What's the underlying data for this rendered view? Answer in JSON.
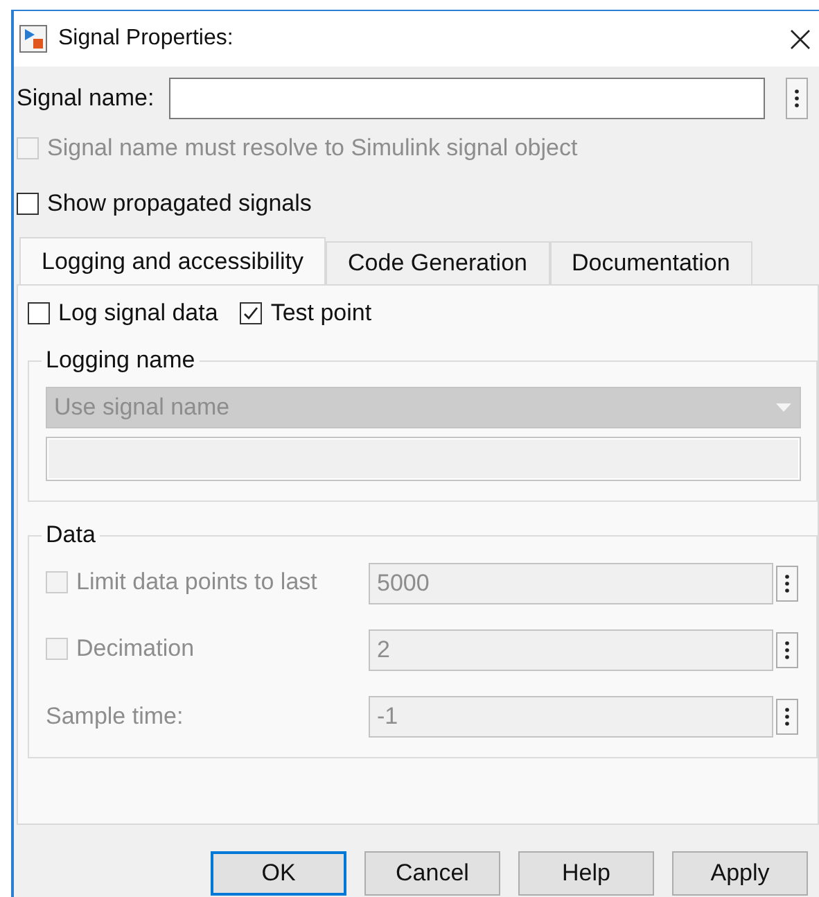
{
  "window": {
    "title": "Signal Properties:"
  },
  "signal_name": {
    "label": "Signal name:"
  },
  "options": [
    {
      "label": "Signal name must resolve to Simulink signal object",
      "checked": false,
      "disabled": true
    },
    {
      "label": "Show propagated signals",
      "checked": false,
      "disabled": false
    }
  ],
  "tabs": [
    {
      "label": "Logging and accessibility",
      "selected": true
    },
    {
      "label": "Code Generation",
      "selected": false
    },
    {
      "label": "Documentation",
      "selected": false
    }
  ],
  "log_options": [
    {
      "label": "Log signal data",
      "checked": false,
      "disabled": false
    },
    {
      "label": "Test point",
      "checked": true,
      "disabled": false
    }
  ],
  "logging_name": {
    "title": "Logging name",
    "mode": {
      "value": "Use signal name",
      "disabled": true
    },
    "name_field": {
      "disabled": true
    }
  },
  "data": {
    "title": "Data",
    "rows": [
      {
        "kind": "checkbox",
        "label": "Limit data points to last",
        "checked": false,
        "value": "5000",
        "disabled": true
      },
      {
        "kind": "checkbox",
        "label": "Decimation",
        "checked": false,
        "value": "2",
        "disabled": true
      },
      {
        "kind": "label",
        "label": "Sample time:",
        "value": "-1",
        "disabled": true
      }
    ]
  },
  "buttons": [
    {
      "label": "OK",
      "default": true
    },
    {
      "label": "Cancel",
      "default": false
    },
    {
      "label": "Help",
      "default": false
    },
    {
      "label": "Apply",
      "default": false
    }
  ]
}
